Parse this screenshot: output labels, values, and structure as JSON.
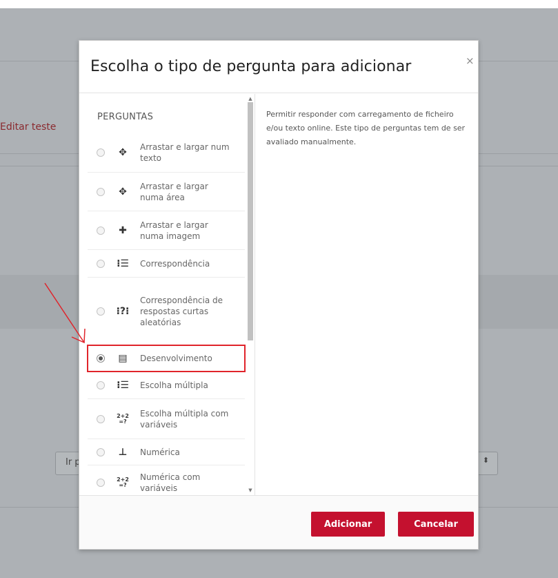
{
  "background": {
    "edit_link": "Editar teste",
    "left_field_text": "Ir p",
    "right_field_arrows": "⬍"
  },
  "modal": {
    "title": "Escolha o tipo de pergunta para adicionar",
    "close_glyph": "×",
    "section_heading": "PERGUNTAS",
    "options": [
      {
        "icon": "drag-text-icon",
        "glyph": "✥",
        "label": "Arrastar e largar num texto",
        "selected": false
      },
      {
        "icon": "drag-area-icon",
        "glyph": "✥",
        "label": "Arrastar e largar numa área",
        "selected": false
      },
      {
        "icon": "drag-image-icon",
        "glyph": "✚",
        "label": "Arrastar e largar numa imagem",
        "selected": false
      },
      {
        "icon": "matching-icon",
        "glyph": "⁝☰",
        "label": "Correspondência",
        "selected": false
      },
      {
        "icon": "random-short-answer-icon",
        "glyph": "⁝?⁝",
        "label": "Correspondência de respostas curtas aleatórias",
        "selected": false
      },
      {
        "icon": "essay-icon",
        "glyph": "▤",
        "label": "Desenvolvimento",
        "selected": true
      },
      {
        "icon": "multiple-choice-icon",
        "glyph": "⁝☰",
        "label": "Escolha múltipla",
        "selected": false
      },
      {
        "icon": "calculated-multichoice-icon",
        "glyph": "2+2 =?",
        "label": "Escolha múltipla com variáveis",
        "selected": false
      },
      {
        "icon": "numerical-icon",
        "glyph": "⊥",
        "label": "Numérica",
        "selected": false
      },
      {
        "icon": "calculated-icon",
        "glyph": "2+2 =?",
        "label": "Numérica com variáveis",
        "selected": false
      }
    ],
    "description": "Permitir responder com carregamento de ficheiro e/ou texto online. Este tipo de perguntas tem de ser avaliado manualmente.",
    "add_button": "Adicionar",
    "cancel_button": "Cancelar"
  },
  "colors": {
    "accent": "#c4112f",
    "highlight": "#e0232a",
    "link": "#8a2a2f"
  }
}
